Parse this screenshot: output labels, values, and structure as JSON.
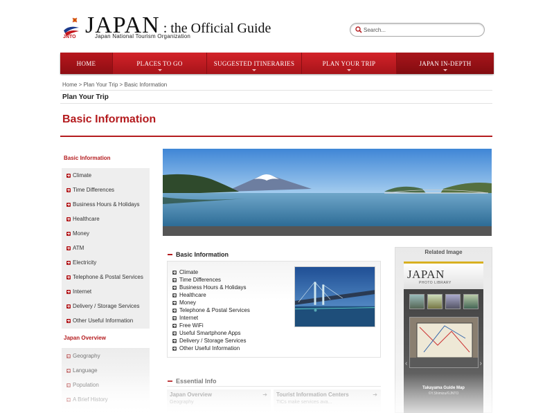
{
  "header": {
    "logo_title_big": "JAPAN",
    "logo_title_rest": " : the Official Guide",
    "logo_subtitle": "Japan National Tourism Organization",
    "jnto": "JNTO"
  },
  "search": {
    "placeholder": "Search..."
  },
  "nav": {
    "items": [
      {
        "label": "Home"
      },
      {
        "label": "Places to go"
      },
      {
        "label": "Suggested Itineraries"
      },
      {
        "label": "Plan your trip"
      },
      {
        "label": "Japan In-Depth"
      }
    ]
  },
  "breadcrumb": {
    "home": "Home",
    "sep": " > ",
    "plan": "Plan Your Trip",
    "current": "Basic Information"
  },
  "section_title": "Plan Your Trip",
  "page_title": "Basic Information",
  "sidebar": {
    "heading1": "Basic Information",
    "group1": [
      "Climate",
      "Time Differences",
      "Business Hours & Holidays",
      "Healthcare",
      "Money",
      "ATM",
      "Electricity",
      "Telephone & Postal Services",
      "Internet",
      "Delivery / Storage Services",
      "Other Useful Information"
    ],
    "heading2": "Japan Overview",
    "group2": [
      "Geography",
      "Language",
      "Population",
      "A Brief History"
    ]
  },
  "basic_info": {
    "title": "Basic Information",
    "items": [
      "Climate",
      "Time Differences",
      "Business Hours & Holidays",
      "Healthcare",
      "Money",
      "Telephone & Postal Services",
      "Internet",
      "Free WiFi",
      "Useful Smartphone Apps",
      "Delivery / Storage Services",
      "Other Useful Information"
    ]
  },
  "essential_info": {
    "title": "Essential Info",
    "col1_head": "Japan Overview",
    "col1_sub": "Geography",
    "col2_head": "Tourist Information Centers",
    "col2_sub": "TICs make services ava..."
  },
  "related": {
    "title": "Related Image",
    "logo": "JAPAN",
    "logo_sub": "PHOTO LIBRARY",
    "caption": "Takayama Guide Map",
    "credit": "©Y.Shimizu/©JNTO"
  },
  "colors": {
    "brand_red": "#b41b1e",
    "nav_red": "#d32229"
  }
}
